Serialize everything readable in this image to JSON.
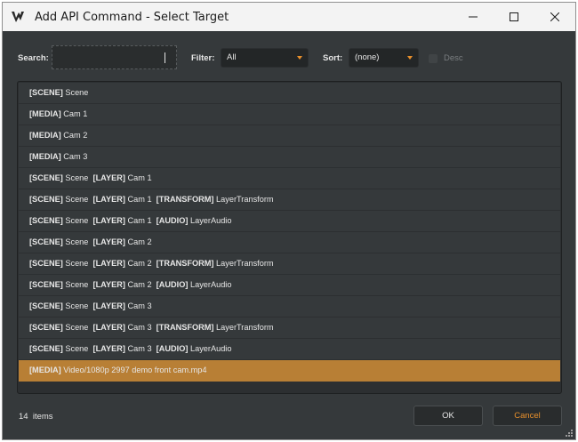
{
  "window": {
    "title": "Add API Command - Select Target"
  },
  "toolbar": {
    "search_label": "Search:",
    "search_value": "",
    "filter_label": "Filter:",
    "filter_value": "All",
    "sort_label": "Sort:",
    "sort_value": "(none)",
    "desc_label": "Desc"
  },
  "list": {
    "items": [
      [
        {
          "tag": "[SCENE]",
          "name": "Scene"
        }
      ],
      [
        {
          "tag": "[MEDIA]",
          "name": "Cam 1"
        }
      ],
      [
        {
          "tag": "[MEDIA]",
          "name": "Cam 2"
        }
      ],
      [
        {
          "tag": "[MEDIA]",
          "name": "Cam 3"
        }
      ],
      [
        {
          "tag": "[SCENE]",
          "name": "Scene"
        },
        {
          "tag": "[LAYER]",
          "name": "Cam 1"
        }
      ],
      [
        {
          "tag": "[SCENE]",
          "name": "Scene"
        },
        {
          "tag": "[LAYER]",
          "name": "Cam 1"
        },
        {
          "tag": "[TRANSFORM]",
          "name": "LayerTransform"
        }
      ],
      [
        {
          "tag": "[SCENE]",
          "name": "Scene"
        },
        {
          "tag": "[LAYER]",
          "name": "Cam 1"
        },
        {
          "tag": "[AUDIO]",
          "name": "LayerAudio"
        }
      ],
      [
        {
          "tag": "[SCENE]",
          "name": "Scene"
        },
        {
          "tag": "[LAYER]",
          "name": "Cam 2"
        }
      ],
      [
        {
          "tag": "[SCENE]",
          "name": "Scene"
        },
        {
          "tag": "[LAYER]",
          "name": "Cam 2"
        },
        {
          "tag": "[TRANSFORM]",
          "name": "LayerTransform"
        }
      ],
      [
        {
          "tag": "[SCENE]",
          "name": "Scene"
        },
        {
          "tag": "[LAYER]",
          "name": "Cam 2"
        },
        {
          "tag": "[AUDIO]",
          "name": "LayerAudio"
        }
      ],
      [
        {
          "tag": "[SCENE]",
          "name": "Scene"
        },
        {
          "tag": "[LAYER]",
          "name": "Cam 3"
        }
      ],
      [
        {
          "tag": "[SCENE]",
          "name": "Scene"
        },
        {
          "tag": "[LAYER]",
          "name": "Cam 3"
        },
        {
          "tag": "[TRANSFORM]",
          "name": "LayerTransform"
        }
      ],
      [
        {
          "tag": "[SCENE]",
          "name": "Scene"
        },
        {
          "tag": "[LAYER]",
          "name": "Cam 3"
        },
        {
          "tag": "[AUDIO]",
          "name": "LayerAudio"
        }
      ],
      [
        {
          "tag": "[MEDIA]",
          "name": "Video/1080p 2997 demo front cam.mp4"
        }
      ]
    ],
    "selected_index": 13
  },
  "footer": {
    "count": "14",
    "count_suffix": "items",
    "ok_label": "OK",
    "cancel_label": "Cancel"
  },
  "colors": {
    "accent": "#e8902c",
    "selection": "#b87f35",
    "panel": "#35393b",
    "titlebar": "#f3f3f3"
  },
  "icons": {
    "app": "vmix-logo-icon",
    "minimize": "minimize-icon",
    "maximize": "maximize-icon",
    "close": "close-icon",
    "dropdown": "chevron-down-icon",
    "grip": "resize-grip-icon"
  }
}
